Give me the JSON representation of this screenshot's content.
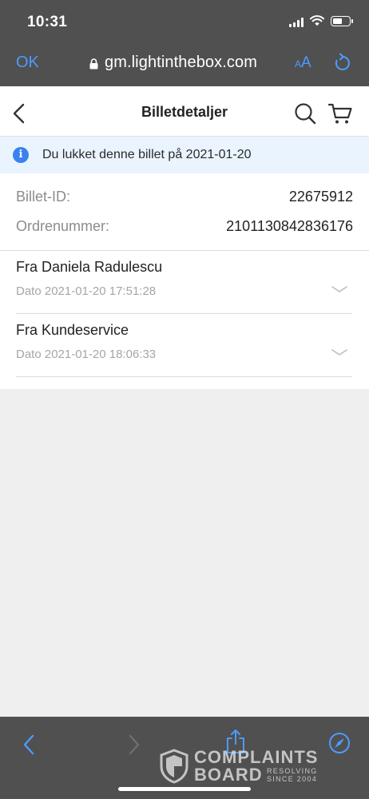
{
  "status_bar": {
    "time": "10:31",
    "battery_level": 0.6
  },
  "browser": {
    "done_label": "OK",
    "url": "gm.lightinthebox.com",
    "text_size_small": "A",
    "text_size_large": "A",
    "accent_color": "#4d9bff"
  },
  "header": {
    "title": "Billetdetaljer"
  },
  "notice": {
    "icon": "info-icon",
    "text": "Du lukket denne billet på 2021-01-20"
  },
  "ticket": {
    "id_label": "Billet-ID:",
    "id_value": "22675912",
    "order_label": "Ordrenummer:",
    "order_value": "2101130842836176"
  },
  "messages": [
    {
      "from": "Fra Daniela Radulescu",
      "date": "Dato 2021-01-20 17:51:28"
    },
    {
      "from": "Fra Kundeservice",
      "date": "Dato 2021-01-20 18:06:33"
    }
  ],
  "watermark": {
    "line1": "COMPLAINTS",
    "line2": "BOARD",
    "tag1": "RESOLVING",
    "tag2": "SINCE 2004"
  }
}
